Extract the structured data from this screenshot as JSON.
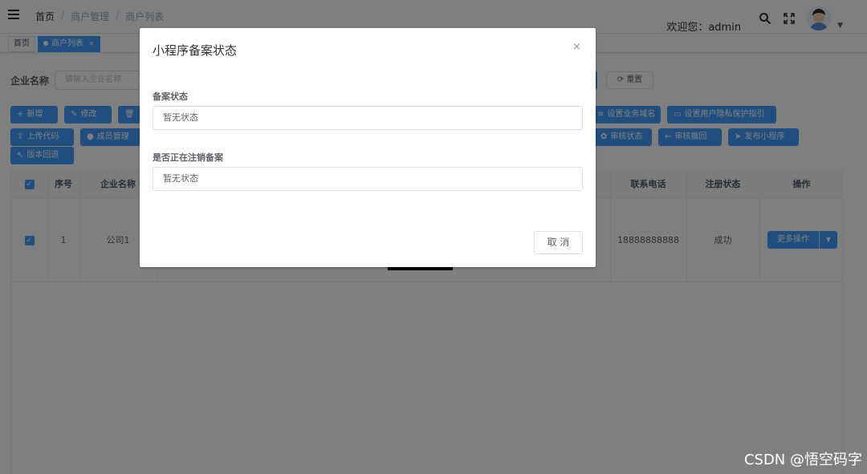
{
  "header": {
    "breadcrumb": [
      "首页",
      "商户管理",
      "商户列表"
    ],
    "welcome": "欢迎您：admin"
  },
  "tags": {
    "home": "首页",
    "active": "商户列表",
    "close": "×"
  },
  "search": {
    "label": "企业名称",
    "placeholder": "请输入企业名称",
    "reset_label": "重置"
  },
  "toolbar": {
    "add": "新增",
    "edit": "修改",
    "set_domain": "设置业务域名",
    "set_privacy": "设置用户隐私保护指引",
    "upload_code": "上传代码",
    "members": "成员管理",
    "audit_status": "审核状态",
    "audit_revoke": "审核撤回",
    "publish": "发布小程序",
    "rollback": "版本回退"
  },
  "table": {
    "headers": {
      "index": "序号",
      "company": "企业名称",
      "phone": "联系电话",
      "reg_status": "注册状态",
      "action": "操作"
    },
    "row": {
      "index": "1",
      "company": "公司1",
      "phone": "18888888888",
      "reg_status": "成功",
      "more": "更多操作"
    }
  },
  "dialog": {
    "title": "小程序备案状态",
    "close": "×",
    "field1_label": "备案状态",
    "field1_value": "暂无状态",
    "field2_label": "是否正在注销备案",
    "field2_value": "暂无状态",
    "cancel": "取 消"
  },
  "watermark": "CSDN @悟空码字"
}
